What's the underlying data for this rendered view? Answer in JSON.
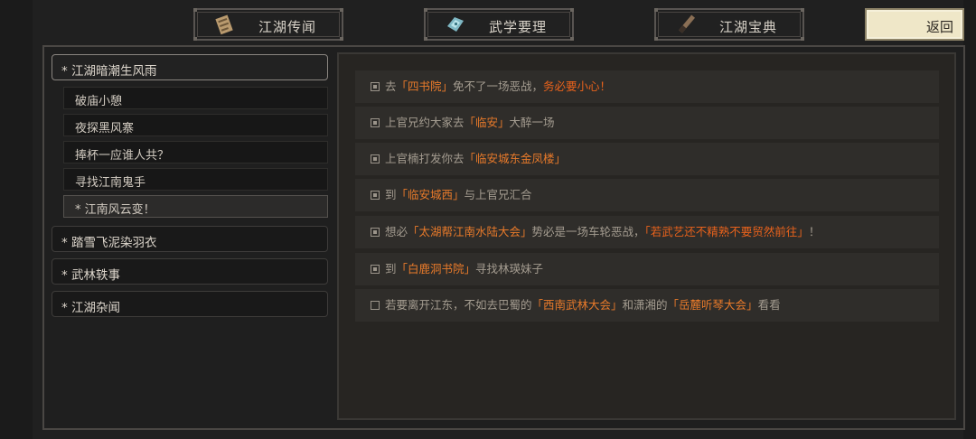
{
  "tabs": [
    {
      "label": "江湖传闻",
      "icon": "scroll-icon"
    },
    {
      "label": "武学要理",
      "icon": "crystal-icon"
    },
    {
      "label": "江湖宝典",
      "icon": "brush-icon"
    }
  ],
  "back_label": "返回",
  "chapters": [
    {
      "label": "* 江湖暗潮生风雨",
      "active": true
    },
    {
      "label": "* 踏雪飞泥染羽衣"
    },
    {
      "label": "* 武林轶事"
    },
    {
      "label": "* 江湖杂闻"
    }
  ],
  "subitems": [
    {
      "label": "破庙小憩"
    },
    {
      "label": "夜探黑风寨"
    },
    {
      "label": "捧杯一应谁人共？"
    },
    {
      "label": "寻找江南鬼手"
    },
    {
      "label": "* 江南风云变！",
      "selected": true
    }
  ],
  "quests": [
    {
      "done": true,
      "parts": [
        {
          "t": "去"
        },
        {
          "t": "「四书院」",
          "h": 1
        },
        {
          "t": "免不了一场恶战，"
        },
        {
          "t": "务必要小心！",
          "h": 2
        }
      ]
    },
    {
      "done": true,
      "parts": [
        {
          "t": "上官兄约大家去"
        },
        {
          "t": "「临安」",
          "h": 1
        },
        {
          "t": "大醉一场"
        }
      ]
    },
    {
      "done": true,
      "parts": [
        {
          "t": "上官楠打发你去"
        },
        {
          "t": "「临安城东金凤楼」",
          "h": 1
        }
      ]
    },
    {
      "done": true,
      "parts": [
        {
          "t": "到"
        },
        {
          "t": "「临安城西」",
          "h": 1
        },
        {
          "t": "与上官兄汇合"
        }
      ]
    },
    {
      "done": true,
      "parts": [
        {
          "t": "想必"
        },
        {
          "t": "「太湖帮江南水陆大会」",
          "h": 1
        },
        {
          "t": "势必是一场车轮恶战，"
        },
        {
          "t": "「若武艺还不精熟不要贸然前往」",
          "h": 2
        },
        {
          "t": "！"
        }
      ]
    },
    {
      "done": true,
      "parts": [
        {
          "t": "到"
        },
        {
          "t": "「白鹿洞书院」",
          "h": 1
        },
        {
          "t": "寻找林瑛妹子"
        }
      ]
    },
    {
      "done": false,
      "parts": [
        {
          "t": "若要离开江东，不如去巴蜀的"
        },
        {
          "t": "「西南武林大会」",
          "h": 1
        },
        {
          "t": "和潇湘的"
        },
        {
          "t": "「岳麓听琴大会」",
          "h": 1
        },
        {
          "t": "看看"
        }
      ]
    }
  ]
}
